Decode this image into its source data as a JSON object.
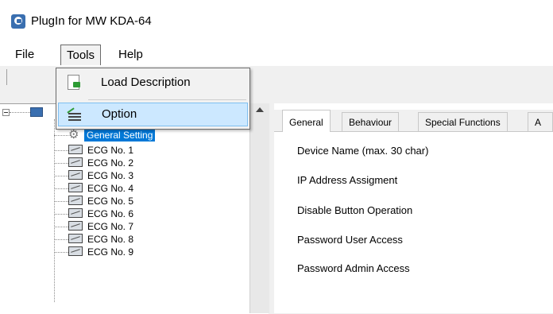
{
  "window": {
    "title": "PlugIn for MW KDA-64"
  },
  "menu": {
    "file": "File",
    "tools": "Tools",
    "help": "Help"
  },
  "tools_menu": {
    "items": [
      {
        "label": "Load Description",
        "icon": "load-description-icon"
      },
      {
        "label": "Option",
        "icon": "option-icon"
      }
    ]
  },
  "tree": {
    "items": [
      {
        "label": "General Setting",
        "icon": "gear-icon",
        "selected": true
      },
      {
        "label": "ECG No. 1",
        "icon": "ecg-icon"
      },
      {
        "label": "ECG No. 2",
        "icon": "ecg-icon"
      },
      {
        "label": "ECG No. 3",
        "icon": "ecg-icon"
      },
      {
        "label": "ECG No. 4",
        "icon": "ecg-icon"
      },
      {
        "label": "ECG No. 5",
        "icon": "ecg-icon"
      },
      {
        "label": "ECG No. 6",
        "icon": "ecg-icon"
      },
      {
        "label": "ECG No. 7",
        "icon": "ecg-icon"
      },
      {
        "label": "ECG No. 8",
        "icon": "ecg-icon"
      },
      {
        "label": "ECG No. 9",
        "icon": "ecg-icon"
      }
    ]
  },
  "tabs": [
    {
      "label": "General",
      "active": true
    },
    {
      "label": "Behaviour"
    },
    {
      "label": "Special Functions"
    },
    {
      "label": "A"
    }
  ],
  "general": {
    "fields": [
      "Device Name (max. 30 char)",
      "IP Address Assigment",
      "Disable Button Operation",
      "Password User Access",
      "Password Admin Access"
    ]
  },
  "colors": {
    "selection": "#0078d7",
    "menu_highlight": "#cce8ff"
  }
}
